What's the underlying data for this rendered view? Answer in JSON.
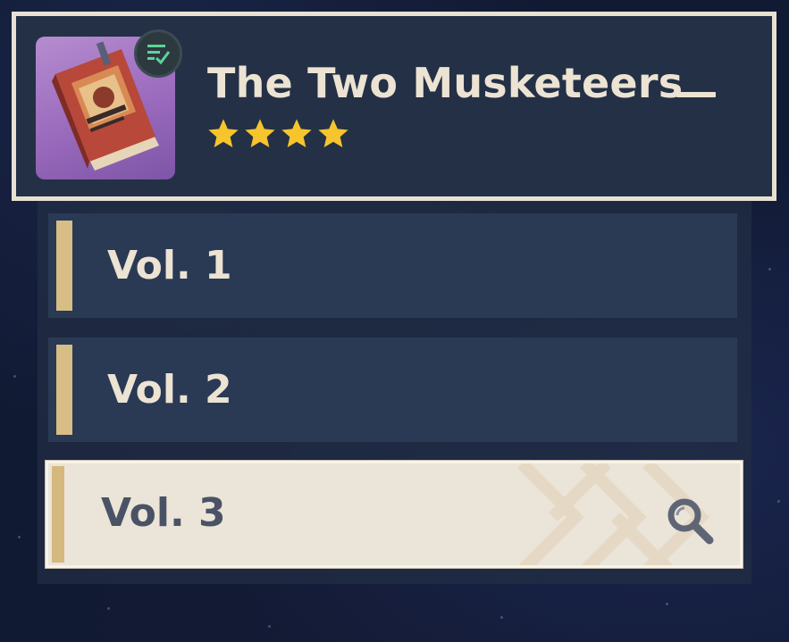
{
  "book": {
    "title": "The Two Musketeers _",
    "rarity_stars": 4,
    "thumbnail_icon": "book-icon",
    "badge_icon": "read-check-icon"
  },
  "volumes": [
    {
      "label": "Vol. 1",
      "selected": false
    },
    {
      "label": "Vol. 2",
      "selected": false
    },
    {
      "label": "Vol. 3",
      "selected": true,
      "icon": "search-icon"
    }
  ],
  "colors": {
    "background": "#111a33",
    "header_panel": "#243046",
    "header_border": "#e8e1d2",
    "volume_item": "#2a3a55",
    "volume_accent": "#d7bd86",
    "selected_item": "#ebe4d8",
    "star": "#f6c42c",
    "text_light": "#ece3d3",
    "text_dark": "#4a5366"
  }
}
